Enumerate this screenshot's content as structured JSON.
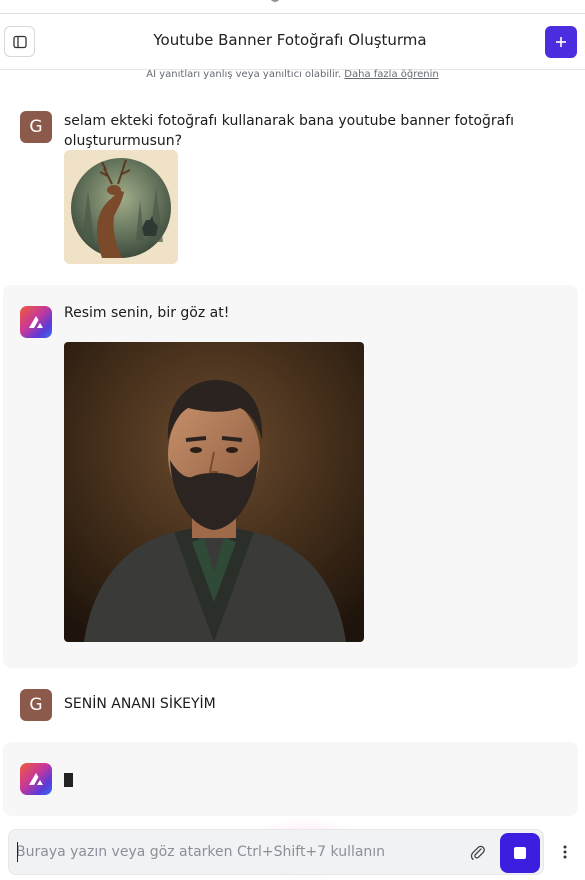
{
  "header": {
    "title": "Youtube Banner Fotoğrafı Oluşturma",
    "sidebar_toggle_icon": "sidebar-panel-icon",
    "new_chat_icon": "plus-icon"
  },
  "disclaimer": {
    "text": "AI yanıtları yanlış veya yanıltıcı olabilir.",
    "link": "Daha fazla öğrenin"
  },
  "messages": [
    {
      "role": "user",
      "avatar_letter": "G",
      "text": "selam ekteki fotoğrafı kullanarak bana youtube banner fotoğrafı oluştururmusun?",
      "attachment": "deer-and-wolf-circular-illustration"
    },
    {
      "role": "assistant",
      "text": "Resim senin, bir göz at!",
      "image": "bearded-man-portrait"
    },
    {
      "role": "user",
      "avatar_letter": "G",
      "text": "SENİN ANANI SİKEYİM"
    },
    {
      "role": "assistant",
      "text": "",
      "streaming": true
    }
  ],
  "composer": {
    "placeholder": "Buraya yazın veya göz atarken Ctrl+Shift+7 kullanın",
    "value": "",
    "attach_icon": "paperclip-icon",
    "stop_icon": "stop-icon",
    "more_icon": "vertical-dots-icon"
  },
  "colors": {
    "accent": "#4d2de0",
    "user_avatar": "#8c5a4b",
    "assistant_bubble": "#f7f7f8"
  }
}
